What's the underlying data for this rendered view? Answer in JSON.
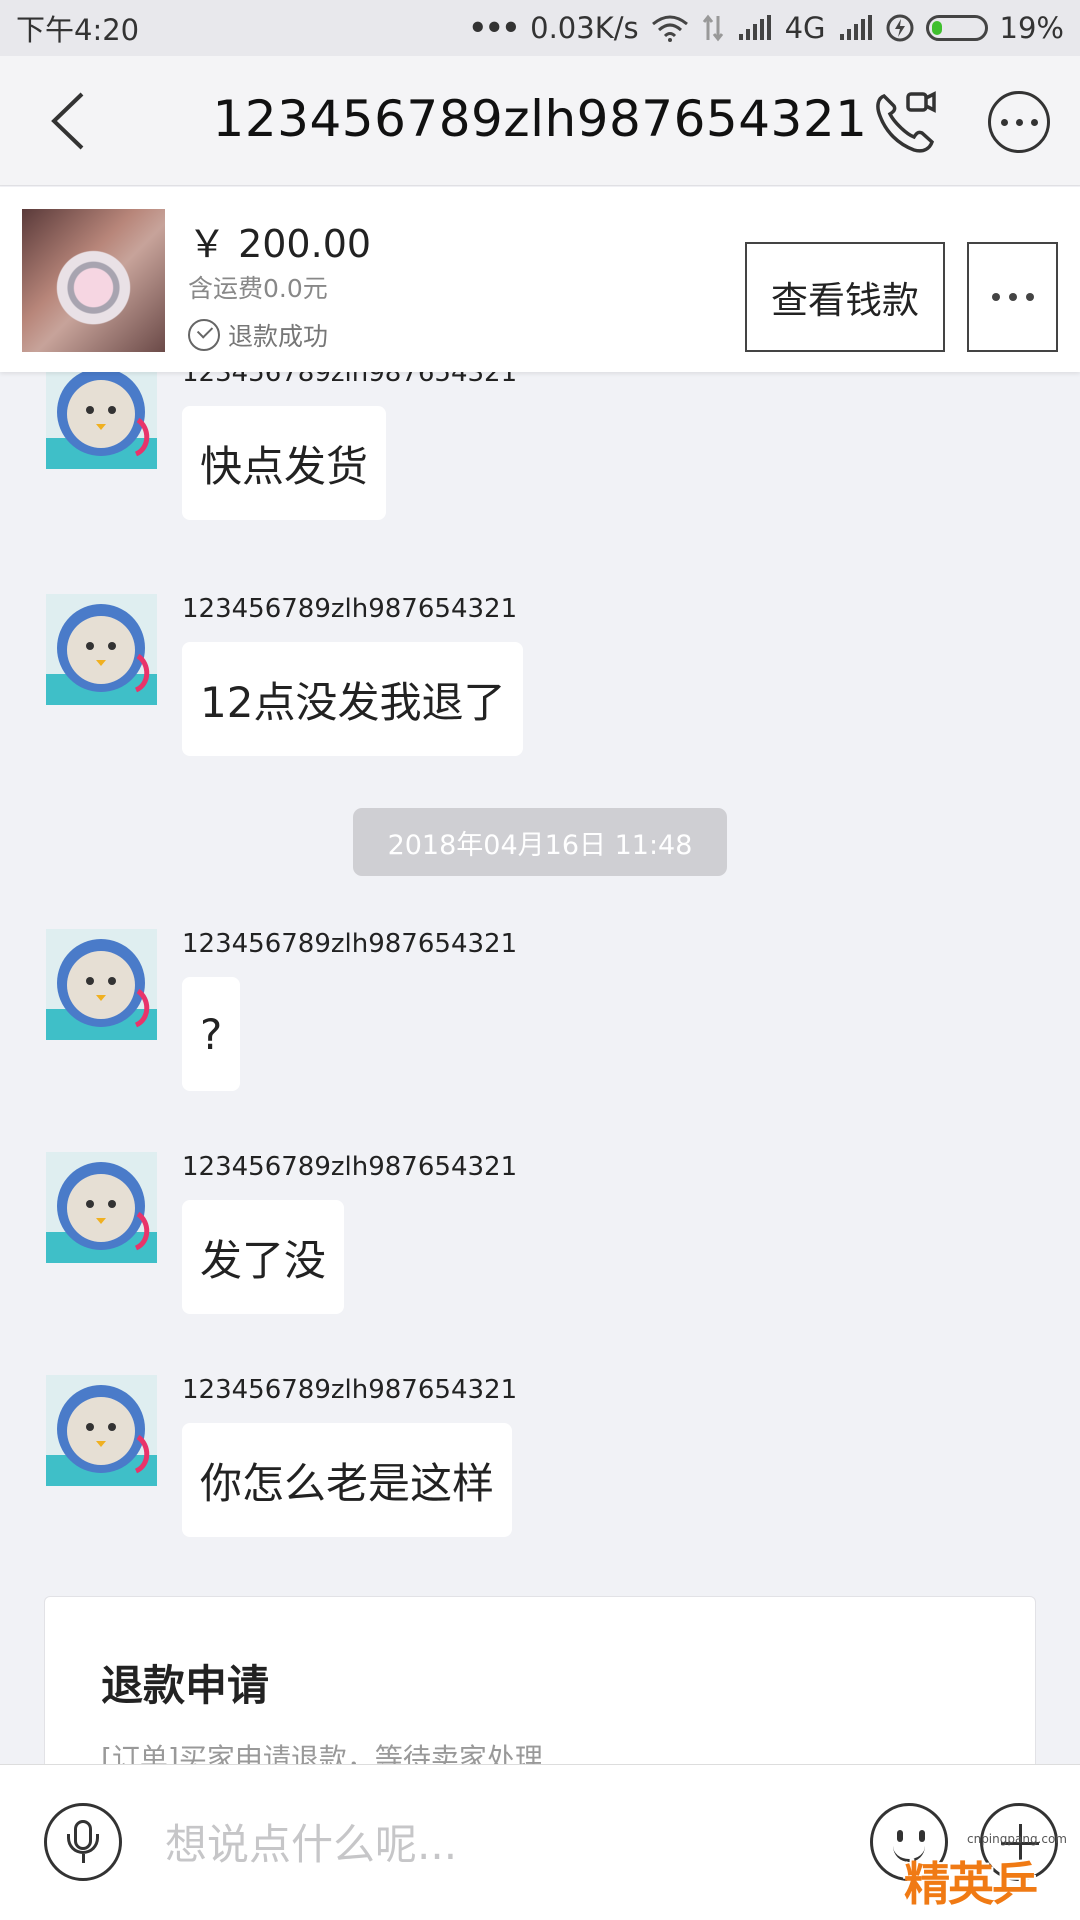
{
  "status_bar": {
    "time": "下午4:20",
    "dots": "•••",
    "network_speed": "0.03K/s",
    "network_type": "4G",
    "battery": "19%"
  },
  "nav": {
    "title": "123456789zlh987654321"
  },
  "order": {
    "price": "￥ 200.00",
    "shipping": "含运费0.0元",
    "status": "退款成功",
    "view_money_label": "查看钱款"
  },
  "messages": [
    {
      "sender": "123456789zlh987654321",
      "text": "快点发货"
    },
    {
      "sender": "123456789zlh987654321",
      "text": "12点没发我退了"
    },
    {
      "sender": "123456789zlh987654321",
      "text": "?"
    },
    {
      "sender": "123456789zlh987654321",
      "text": "发了没"
    },
    {
      "sender": "123456789zlh987654321",
      "text": "你怎么老是这样"
    }
  ],
  "timestamp": "2018年04月16日 11:48",
  "refund_card": {
    "title": "退款申请",
    "desc": "[订单]买家申请退款，等待卖家处理"
  },
  "input": {
    "placeholder": "想说点什么呢..."
  },
  "watermark": {
    "url": "cnpingpang.com",
    "text": "精英乒乓网"
  }
}
